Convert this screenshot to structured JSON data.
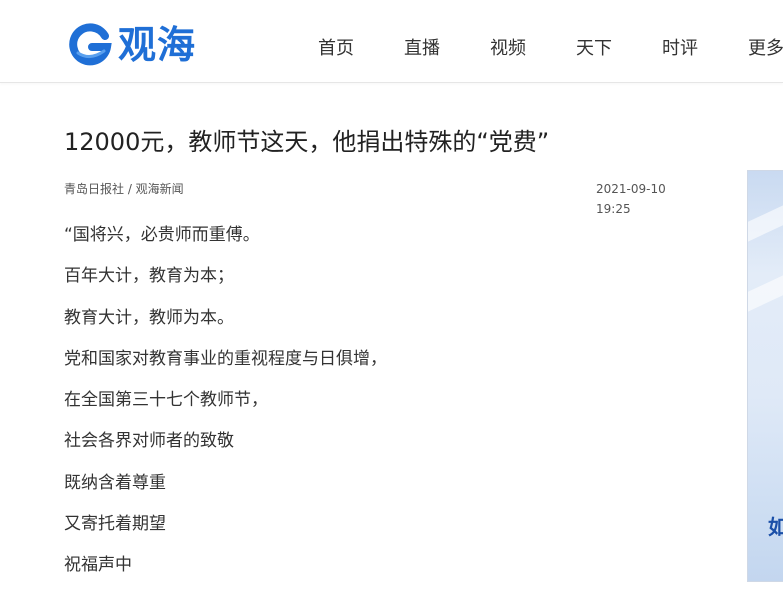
{
  "header": {
    "logo_text": "观海",
    "nav": [
      "首页",
      "直播",
      "视频",
      "天下",
      "时评",
      "更多"
    ]
  },
  "article": {
    "title": "12000元，教师节这天，他捐出特殊的“党费”",
    "source": "青岛日报社 / 观海新闻",
    "time": "2021-09-10 19:25",
    "paragraphs": [
      "“国将兴，必贵师而重傅。",
      "百年大计，教育为本；",
      "教育大计，教师为本。",
      "党和国家对教育事业的重视程度与日俱增，",
      "在全国第三十七个教师节，",
      "社会各界对师者的致敬",
      "既纳含着尊重",
      "又寄托着期望",
      "祝福声中"
    ]
  },
  "side_banner": {
    "visible_text": "如"
  },
  "colors": {
    "brand": "#1f6fd6",
    "text": "#333333",
    "banner": "#dfe9f7"
  }
}
